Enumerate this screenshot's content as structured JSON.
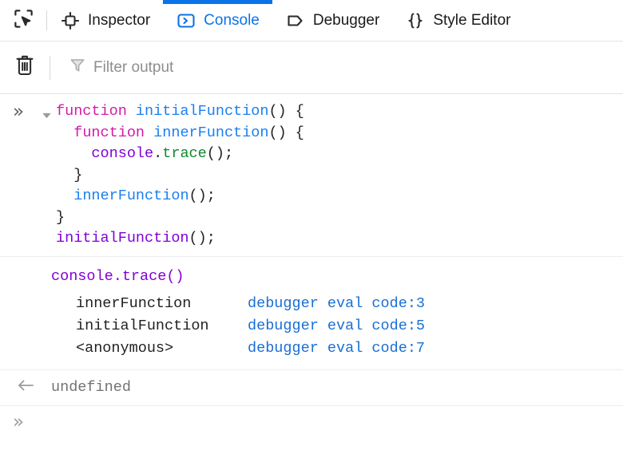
{
  "toolbar": {
    "picker_icon": "element-picker-icon",
    "tabs": [
      {
        "label": "Inspector",
        "icon": "inspector-icon",
        "active": false
      },
      {
        "label": "Console",
        "icon": "console-icon",
        "active": true
      },
      {
        "label": "Debugger",
        "icon": "debugger-icon",
        "active": false
      },
      {
        "label": "Style Editor",
        "icon": "style-editor-icon",
        "active": false
      }
    ],
    "active_tab_color": "#0a73e8"
  },
  "filterbar": {
    "clear_icon": "trash-icon",
    "clear_label": "Clear console output",
    "filter_icon": "filter-funnel-icon",
    "placeholder": "Filter output",
    "value": ""
  },
  "console": {
    "input_echo": {
      "prompt_glyph": "»",
      "twisty": "triangle-down-icon",
      "code_lines": [
        {
          "indent": 0,
          "tokens": [
            {
              "t": "function ",
              "c": "tok-kw"
            },
            {
              "t": "initialFunction",
              "c": "tok-fn"
            },
            {
              "t": "() {",
              "c": "tok-punct"
            }
          ]
        },
        {
          "indent": 1,
          "tokens": [
            {
              "t": "function ",
              "c": "tok-kw"
            },
            {
              "t": "innerFunction",
              "c": "tok-fn"
            },
            {
              "t": "() {",
              "c": "tok-punct"
            }
          ]
        },
        {
          "indent": 2,
          "tokens": [
            {
              "t": "console",
              "c": "tok-obj"
            },
            {
              "t": ".",
              "c": "tok-punct"
            },
            {
              "t": "trace",
              "c": "tok-meth"
            },
            {
              "t": "();",
              "c": "tok-punct"
            }
          ]
        },
        {
          "indent": 1,
          "tokens": [
            {
              "t": "}",
              "c": "tok-punct"
            }
          ]
        },
        {
          "indent": 1,
          "tokens": [
            {
              "t": "innerFunction",
              "c": "tok-fn"
            },
            {
              "t": "();",
              "c": "tok-punct"
            }
          ]
        },
        {
          "indent": 0,
          "tokens": [
            {
              "t": "}",
              "c": "tok-punct"
            }
          ]
        },
        {
          "indent": 0,
          "tokens": [
            {
              "t": "initialFunction",
              "c": "tok-purple"
            },
            {
              "t": "();",
              "c": "tok-punct"
            }
          ]
        }
      ]
    },
    "trace": {
      "title": "console.trace()",
      "title_color": "#8000d7",
      "frames": [
        {
          "function": "innerFunction",
          "location": "debugger eval code:3"
        },
        {
          "function": "initialFunction",
          "location": "debugger eval code:5"
        },
        {
          "function": "<anonymous>",
          "location": "debugger eval code:7"
        }
      ],
      "location_color": "#1a6fd4"
    },
    "result": {
      "arrow_glyph": "←",
      "arrow_icon": "return-arrow-icon",
      "value": "undefined"
    },
    "prompt": {
      "glyph": "»",
      "value": "",
      "placeholder": ""
    }
  }
}
